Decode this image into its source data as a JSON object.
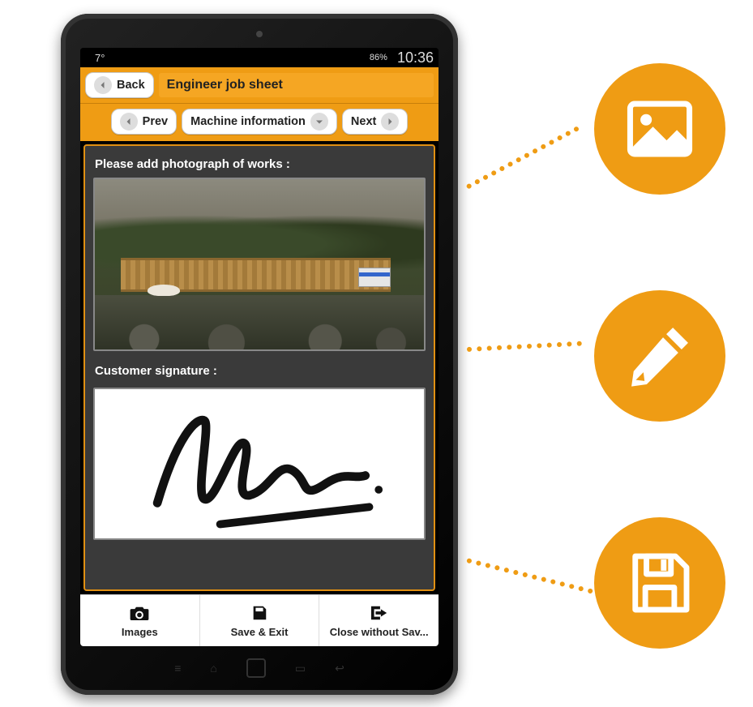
{
  "statusbar": {
    "temperature": "7°",
    "battery_pct": "86%",
    "time": "10:36"
  },
  "header": {
    "back_label": "Back",
    "title": "Engineer job sheet"
  },
  "nav": {
    "prev_label": "Prev",
    "section_label": "Machine information",
    "next_label": "Next"
  },
  "content": {
    "photo_label": "Please add photograph of works :",
    "signature_label": "Customer signature :"
  },
  "actions": {
    "images_label": "Images",
    "save_exit_label": "Save & Exit",
    "close_label": "Close without Sav..."
  },
  "callouts": {
    "image_icon": "image-icon",
    "pencil_icon": "pencil-icon",
    "save_icon": "save-disk-icon"
  }
}
